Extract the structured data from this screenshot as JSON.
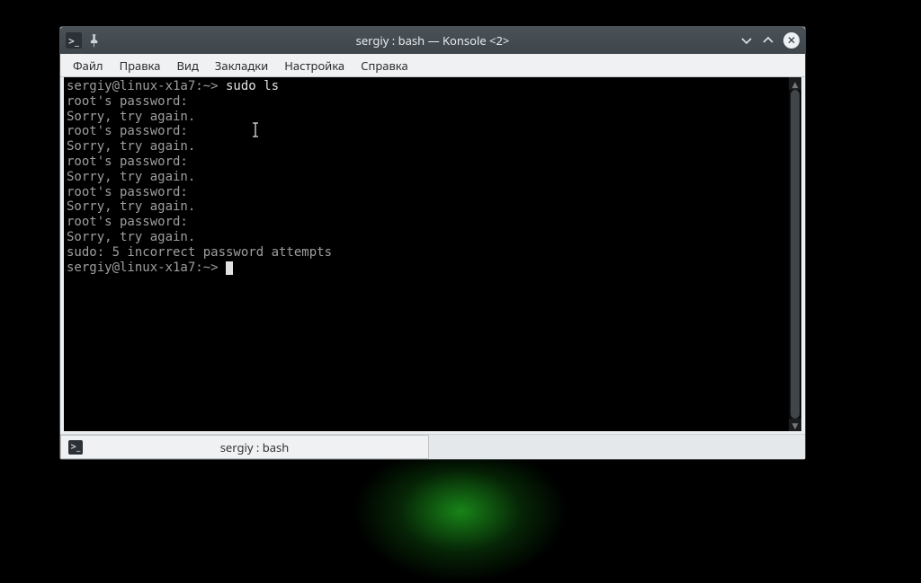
{
  "window": {
    "title": "sergiy : bash — Konsole <2>"
  },
  "menu": {
    "items": [
      "Файл",
      "Правка",
      "Вид",
      "Закладки",
      "Настройка",
      "Справка"
    ]
  },
  "terminal": {
    "lines": [
      {
        "prompt": "sergiy@linux-x1a7:~>",
        "cmd": " sudo ls"
      },
      {
        "text": "root's password:"
      },
      {
        "text": "Sorry, try again."
      },
      {
        "text": "root's password:"
      },
      {
        "text": "Sorry, try again."
      },
      {
        "text": "root's password:"
      },
      {
        "text": "Sorry, try again."
      },
      {
        "text": "root's password:"
      },
      {
        "text": "Sorry, try again."
      },
      {
        "text": "root's password:"
      },
      {
        "text": "Sorry, try again."
      },
      {
        "text": "sudo: 5 incorrect password attempts"
      },
      {
        "prompt": "sergiy@linux-x1a7:~>",
        "cmd": " ",
        "cursor": true
      }
    ]
  },
  "tab": {
    "label": "sergiy : bash"
  },
  "icons": {
    "app_glyph": ">_",
    "pin_glyph": "📌",
    "min_glyph": "v",
    "max_glyph": "^",
    "close_glyph": "✕",
    "sb_up": "▲",
    "sb_down": "▼"
  }
}
